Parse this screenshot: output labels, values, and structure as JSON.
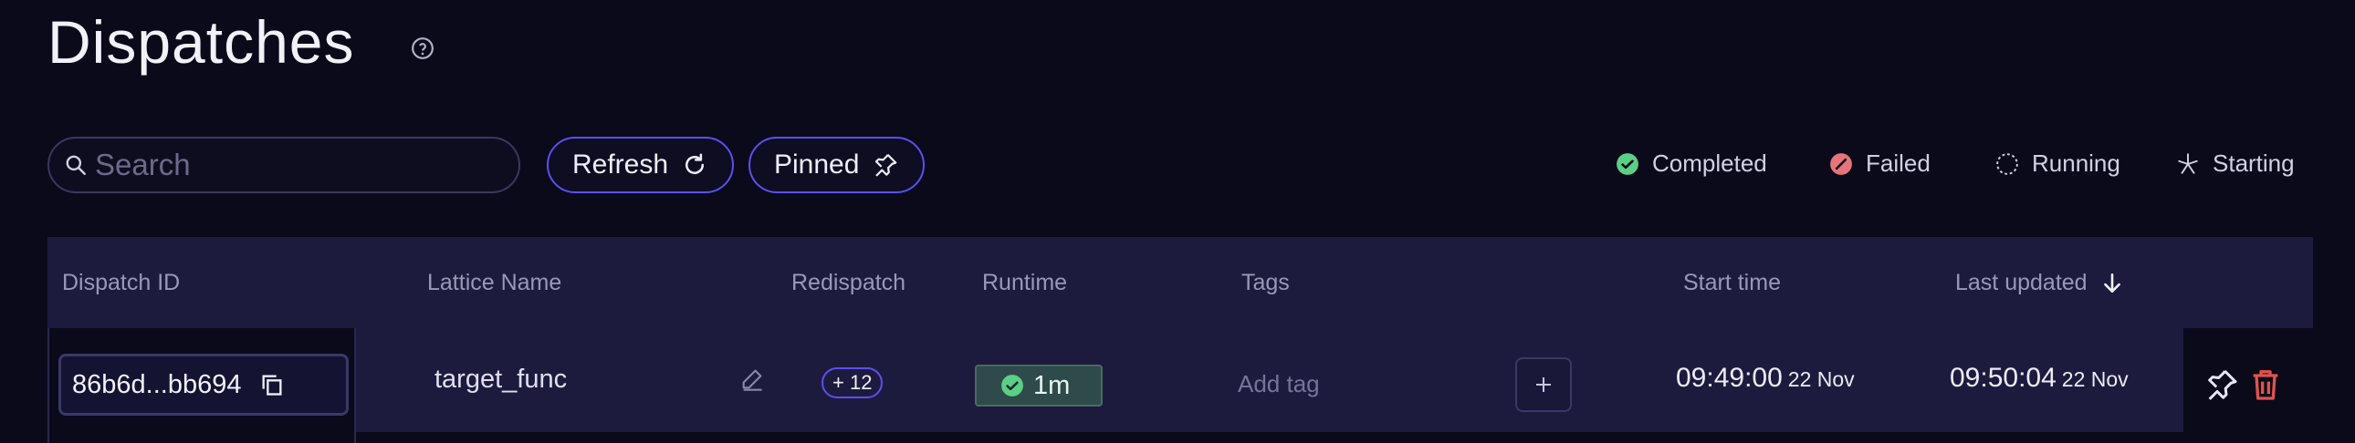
{
  "page": {
    "title": "Dispatches"
  },
  "search": {
    "placeholder": "Search",
    "value": ""
  },
  "toolbar": {
    "refresh_label": "Refresh",
    "pinned_label": "Pinned"
  },
  "legend": {
    "completed": "Completed",
    "failed": "Failed",
    "running": "Running",
    "starting": "Starting"
  },
  "colors": {
    "accent": "#5b50f0",
    "completed": "#5ccf86",
    "failed": "#e5757a",
    "delete": "#e0534c"
  },
  "table": {
    "columns": [
      "Dispatch ID",
      "Lattice Name",
      "Redispatch",
      "Runtime",
      "Tags",
      "Start time",
      "Last updated"
    ],
    "rows": [
      {
        "dispatch_id": "86b6d...bb694",
        "lattice_name": "target_func",
        "redispatch": "+ 12",
        "runtime": "1m",
        "tags_placeholder": "Add tag",
        "start_time": "09:49:00",
        "start_date": "22 Nov",
        "last_updated_time": "09:50:04",
        "last_updated_date": "22 Nov"
      }
    ]
  },
  "icons": [
    "help-icon",
    "search-icon",
    "refresh-icon",
    "pin-icon",
    "check-circle-icon",
    "failed-icon",
    "running-icon",
    "starting-icon",
    "sort-arrow-down-icon",
    "copy-icon",
    "edit-icon",
    "plus-icon",
    "trash-icon"
  ]
}
